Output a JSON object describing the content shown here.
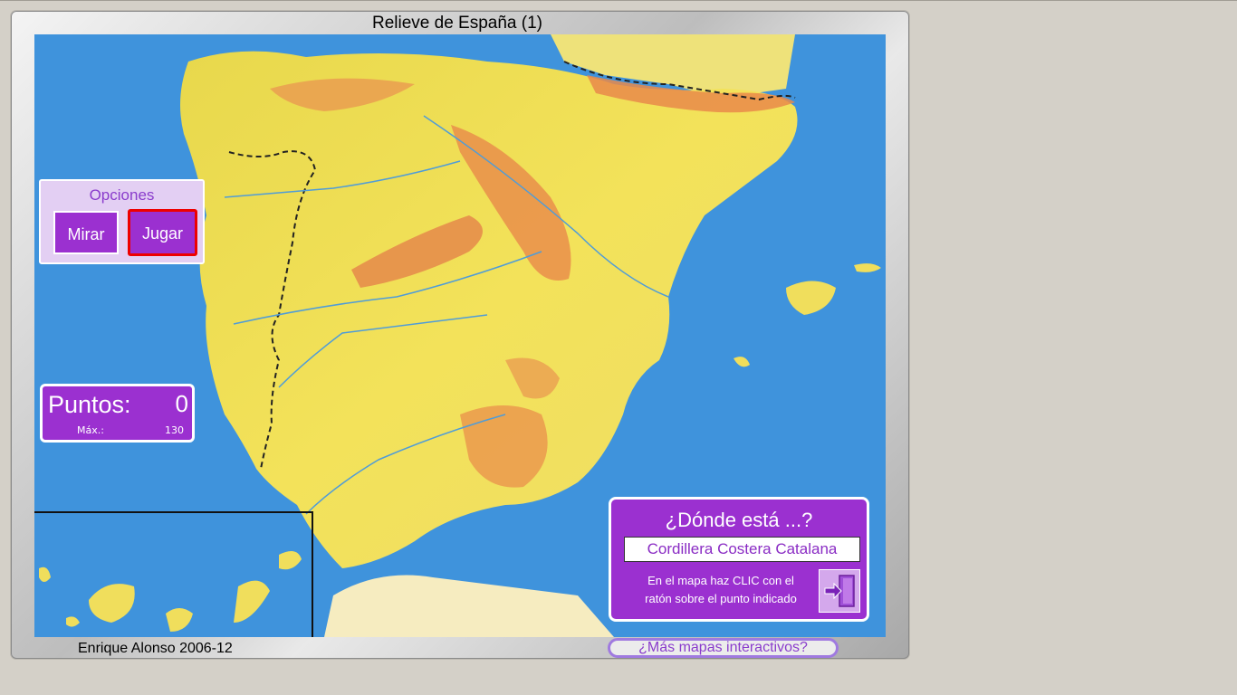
{
  "title": "Relieve de España (1)",
  "options": {
    "heading": "Opciones",
    "mirar_label": "Mirar",
    "jugar_label": "Jugar"
  },
  "score": {
    "label": "Puntos:",
    "value": "0",
    "max_label": "Máx.:",
    "max_value": "130"
  },
  "question": {
    "heading": "¿Dónde está ...?",
    "target": "Cordillera Costera Catalana",
    "instruction_line1": "En el mapa haz CLIC con el",
    "instruction_line2": "ratón sobre el punto indicado",
    "exit_icon": "exit-door-icon"
  },
  "footer": {
    "author": "Enrique Alonso 2006-12",
    "more_maps_link": "¿Más mapas interactivos?"
  },
  "colors": {
    "accent": "#9b30d0",
    "sea": "#3f93dc",
    "land": "#f2e05a",
    "relief": "#e98a4a",
    "active_button_border": "#e00000"
  }
}
